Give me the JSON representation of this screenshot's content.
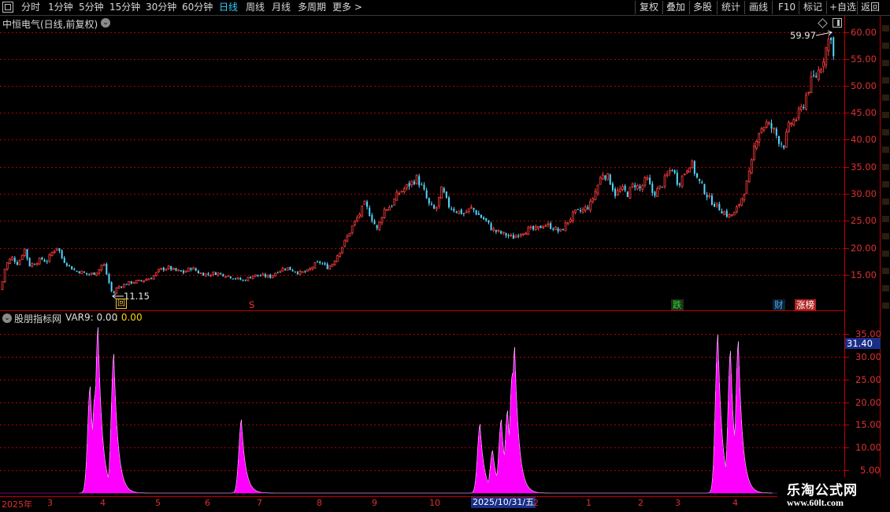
{
  "toolbar": {
    "window_icon": "window-icon",
    "periods": [
      "分时",
      "1分钟",
      "5分钟",
      "15分钟",
      "30分钟",
      "60分钟",
      "日线",
      "周线",
      "月线",
      "多周期"
    ],
    "active_period": "日线",
    "more_label": "更多",
    "actions": [
      "复权",
      "叠加",
      "多股",
      "统计",
      "画线",
      "F10",
      "标记",
      "+自选",
      "返回"
    ]
  },
  "main_chart": {
    "title": "中恒电气(日线,前复权)",
    "price_axis": [
      "60.00",
      "55.00",
      "50.00",
      "45.00",
      "40.00",
      "35.00",
      "30.00",
      "25.00",
      "20.00",
      "15.00"
    ],
    "high_label": "59.97",
    "low_label": "11.15",
    "markers": {
      "hui": "回",
      "s": "S",
      "die": "跌",
      "cai": "财",
      "zhangbang": "涨榜"
    }
  },
  "indicator": {
    "name": "股朋指标网",
    "var_label": "VAR9: 0.00",
    "var_value": ": 0.00",
    "axis": [
      "35.00",
      "30.00",
      "25.00",
      "20.00",
      "15.00",
      "10.00",
      "5.00"
    ],
    "current_value": "31.40"
  },
  "date_axis": {
    "labels": [
      "2025年",
      "3",
      "4",
      "5",
      "6",
      "7",
      "8",
      "9",
      "10",
      "2",
      "1",
      "2",
      "3",
      "4"
    ],
    "cursor_date": "2025/10/31/五"
  },
  "watermark": {
    "name": "乐淘公式网",
    "url": "www.60lt.com"
  },
  "colors": {
    "up": "#ff3d3d",
    "down": "#54d8ff",
    "grid": "#b40000",
    "indicator": "#ff00ff",
    "accent": "#33ccff"
  },
  "chart_data": [
    {
      "type": "candlestick",
      "title": "中恒电气(日线,前复权)",
      "ylim": [
        10,
        62
      ],
      "y_ticks": [
        15,
        20,
        25,
        30,
        35,
        40,
        45,
        50,
        55,
        60
      ],
      "x_tick_labels": [
        "2025年",
        "3",
        "4",
        "5",
        "6",
        "7",
        "8",
        "9",
        "10",
        "2",
        "1",
        "2",
        "3",
        "4"
      ],
      "close_path": [
        [
          0,
          12.5
        ],
        [
          6,
          17
        ],
        [
          14,
          18.5
        ],
        [
          22,
          17.2
        ],
        [
          30,
          20.2
        ],
        [
          36,
          17
        ],
        [
          44,
          17.5
        ],
        [
          52,
          18.2
        ],
        [
          58,
          17.6
        ],
        [
          64,
          19.2
        ],
        [
          72,
          20.5
        ],
        [
          78,
          18.2
        ],
        [
          86,
          17
        ],
        [
          94,
          16
        ],
        [
          102,
          15.8
        ],
        [
          110,
          15.3
        ],
        [
          118,
          15.5
        ],
        [
          124,
          16
        ],
        [
          130,
          17.6
        ],
        [
          136,
          14.5
        ],
        [
          142,
          11.5
        ],
        [
          148,
          13
        ],
        [
          156,
          13.4
        ],
        [
          166,
          13.9
        ],
        [
          178,
          14.1
        ],
        [
          192,
          14.8
        ],
        [
          202,
          16.2
        ],
        [
          212,
          16.6
        ],
        [
          222,
          16
        ],
        [
          232,
          15.7
        ],
        [
          242,
          16.6
        ],
        [
          252,
          15.6
        ],
        [
          262,
          15.3
        ],
        [
          274,
          15.6
        ],
        [
          286,
          15.2
        ],
        [
          298,
          14.6
        ],
        [
          308,
          14.2
        ],
        [
          320,
          15.1
        ],
        [
          332,
          15.1
        ],
        [
          342,
          14.9
        ],
        [
          352,
          16
        ],
        [
          362,
          16.6
        ],
        [
          372,
          16
        ],
        [
          380,
          15.6
        ],
        [
          390,
          15.9
        ],
        [
          398,
          17.1
        ],
        [
          406,
          17.6
        ],
        [
          414,
          16.6
        ],
        [
          420,
          17.1
        ],
        [
          428,
          19.1
        ],
        [
          436,
          21.1
        ],
        [
          446,
          24.1
        ],
        [
          454,
          26.1
        ],
        [
          462,
          28.3
        ],
        [
          470,
          26.1
        ],
        [
          478,
          23.5
        ],
        [
          486,
          27.2
        ],
        [
          496,
          28.1
        ],
        [
          504,
          30.2
        ],
        [
          512,
          31.1
        ],
        [
          520,
          32.1
        ],
        [
          528,
          33.1
        ],
        [
          536,
          31.1
        ],
        [
          544,
          28.1
        ],
        [
          552,
          27.1
        ],
        [
          560,
          31.1
        ],
        [
          568,
          28.1
        ],
        [
          578,
          27.1
        ],
        [
          588,
          26.6
        ],
        [
          598,
          27.6
        ],
        [
          608,
          26.1
        ],
        [
          616,
          25.2
        ],
        [
          624,
          23.6
        ],
        [
          632,
          23.1
        ],
        [
          642,
          22.6
        ],
        [
          650,
          22.1
        ],
        [
          660,
          23.1
        ],
        [
          670,
          23.6
        ],
        [
          680,
          23.6
        ],
        [
          690,
          24.6
        ],
        [
          700,
          24.1
        ],
        [
          710,
          23.1
        ],
        [
          720,
          25.1
        ],
        [
          728,
          26.6
        ],
        [
          738,
          27.1
        ],
        [
          748,
          28.1
        ],
        [
          756,
          31.1
        ],
        [
          764,
          34.1
        ],
        [
          772,
          33.1
        ],
        [
          780,
          30.2
        ],
        [
          788,
          31.1
        ],
        [
          796,
          30.2
        ],
        [
          804,
          32.1
        ],
        [
          812,
          31.1
        ],
        [
          820,
          33.1
        ],
        [
          828,
          30.2
        ],
        [
          836,
          31.1
        ],
        [
          844,
          33.1
        ],
        [
          852,
          35.1
        ],
        [
          860,
          32.1
        ],
        [
          868,
          34.1
        ],
        [
          876,
          36.2
        ],
        [
          884,
          33.1
        ],
        [
          892,
          31.1
        ],
        [
          900,
          29.2
        ],
        [
          908,
          28.1
        ],
        [
          916,
          27.1
        ],
        [
          924,
          26.1
        ],
        [
          932,
          26.6
        ],
        [
          940,
          29.2
        ],
        [
          946,
          31.6
        ],
        [
          952,
          34.6
        ],
        [
          958,
          40.2
        ],
        [
          964,
          42.2
        ],
        [
          972,
          43.2
        ],
        [
          980,
          42.2
        ],
        [
          988,
          40.2
        ],
        [
          994,
          39.2
        ],
        [
          1002,
          43.2
        ],
        [
          1010,
          44.2
        ],
        [
          1018,
          46.2
        ],
        [
          1024,
          49.2
        ],
        [
          1030,
          51.2
        ],
        [
          1036,
          52.2
        ],
        [
          1042,
          54.2
        ],
        [
          1048,
          57.2
        ],
        [
          1054,
          59.97
        ],
        [
          1060,
          51.5
        ]
      ]
    },
    {
      "type": "area",
      "name": "VAR9",
      "ylim": [
        0,
        38
      ],
      "y_ticks": [
        5,
        10,
        15,
        20,
        25,
        30,
        35
      ],
      "peaks": [
        {
          "x": 114,
          "value": 23.5
        },
        {
          "x": 120,
          "value": 21.6
        },
        {
          "x": 124,
          "value": 36.6
        },
        {
          "x": 144,
          "value": 30.7
        },
        {
          "x": 306,
          "value": 16.2
        },
        {
          "x": 609,
          "value": 15.2
        },
        {
          "x": 625,
          "value": 9.4
        },
        {
          "x": 636,
          "value": 16.2
        },
        {
          "x": 644,
          "value": 18.2
        },
        {
          "x": 650,
          "value": 26.4
        },
        {
          "x": 653,
          "value": 32.2
        },
        {
          "x": 911,
          "value": 35.0
        },
        {
          "x": 927,
          "value": 31.4
        },
        {
          "x": 937,
          "value": 33.5
        }
      ]
    }
  ]
}
